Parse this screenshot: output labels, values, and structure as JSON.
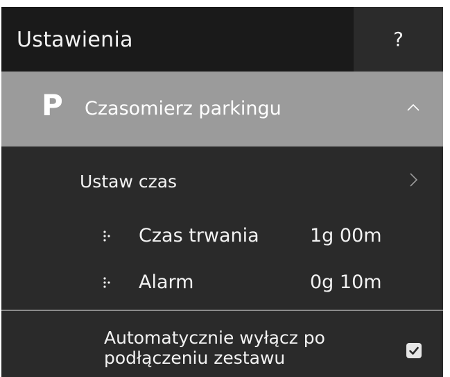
{
  "header": {
    "title": "Ustawienia",
    "help_label": "?"
  },
  "section": {
    "icon_letter": "P",
    "icon": "parking-icon",
    "title": "Czasomierz parkingu",
    "expanded": true,
    "toggle_icon": "chevron-up-icon"
  },
  "set_time": {
    "label": "Ustaw czas",
    "icon": "chevron-right-icon"
  },
  "items": [
    {
      "label": "Czas trwania",
      "value": "1g 00m",
      "icon": "drag-handle-icon"
    },
    {
      "label": "Alarm",
      "value": "0g 10m",
      "icon": "drag-handle-icon"
    }
  ],
  "auto_off": {
    "label": "Automatycznie wyłącz po podłączeniu zestawu",
    "checked": true,
    "icon": "checkbox-icon"
  },
  "colors": {
    "header_bg": "#1a1a1a",
    "help_bg": "#2b2b2b",
    "panel_bg": "#2a2a2a",
    "section_bg": "#9b9b9b",
    "text": "#f2f2f2"
  }
}
